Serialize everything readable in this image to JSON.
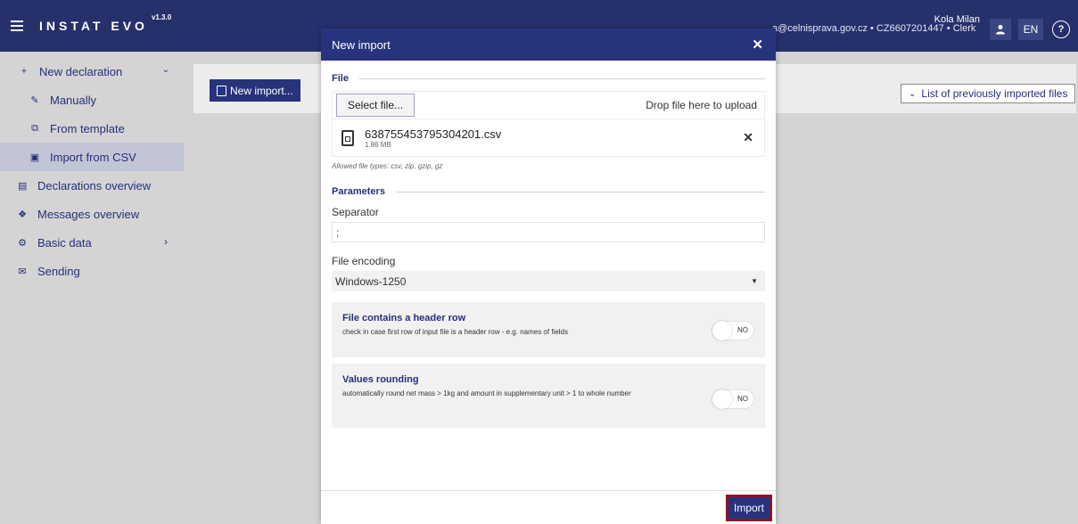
{
  "app": {
    "title": "INSTAT EVO",
    "version": "v1.3.0"
  },
  "user": {
    "email_line": "a@celnisprava.gov.cz • CZ6607201447 • Clerk",
    "name": "Kola Milan",
    "role_line": "ra.gov.cz • CZ6607201447 • Clerk",
    "language": "EN"
  },
  "sidebar": {
    "items": [
      {
        "label": "New declaration"
      },
      {
        "label": "Manually"
      },
      {
        "label": "From template"
      },
      {
        "label": "Import from CSV"
      },
      {
        "label": "Declarations overview"
      },
      {
        "label": "Messages overview"
      },
      {
        "label": "Basic data"
      },
      {
        "label": "Sending"
      }
    ]
  },
  "content": {
    "new_import_label": "New import...",
    "previous_list_label": "List of previously imported files"
  },
  "modal": {
    "title": "New import",
    "file_section": "File",
    "select_file_label": "Select file...",
    "drop_hint": "Drop file here to upload",
    "file_name": "638755453795304201.csv",
    "file_size": "1.86 MB",
    "allowed_types": "Allowed file types: csv, zip, gzip, gz",
    "parameters_section": "Parameters",
    "separator_label": "Separator",
    "separator_value": ";",
    "encoding_label": "File encoding",
    "encoding_value": "Windows-1250",
    "header_row_title": "File contains a header row",
    "header_row_desc": "check in case first row of input file is a header row - e.g. names of fields",
    "header_row_value": "NO",
    "rounding_title": "Values rounding",
    "rounding_desc": "automatically round net mass > 1kg and amount in supplementary unit > 1 to whole number",
    "rounding_value": "NO",
    "import_label": "Import"
  }
}
